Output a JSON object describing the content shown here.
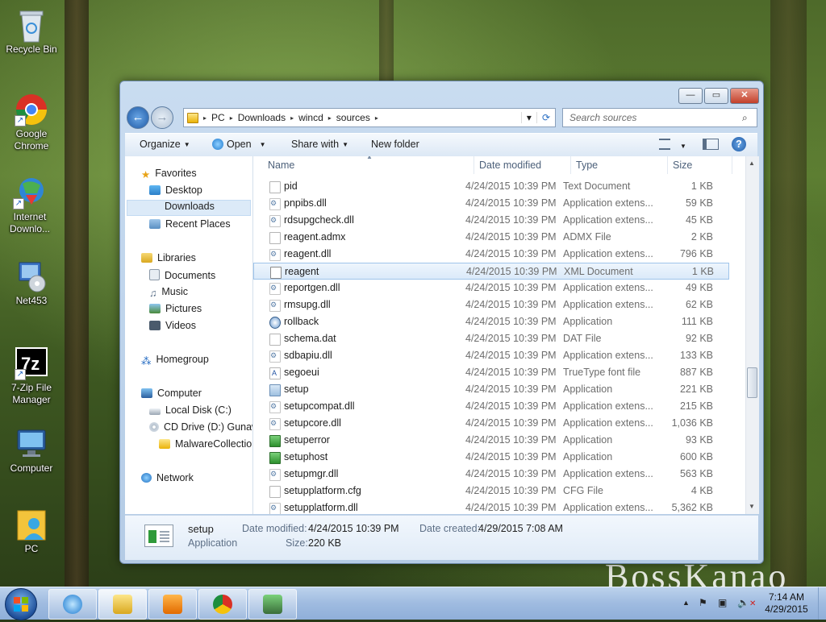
{
  "desktop": {
    "icons": [
      {
        "label": "Recycle Bin"
      },
      {
        "label": "Google Chrome"
      },
      {
        "label": "Internet Downlo..."
      },
      {
        "label": "Net453"
      },
      {
        "label": "7-Zip File Manager"
      },
      {
        "label": "Computer"
      },
      {
        "label": "PC"
      }
    ],
    "watermark": "BossKanao"
  },
  "window": {
    "controls": {
      "minimize": "—",
      "maximize": "▭",
      "close": "✕"
    },
    "nav": {
      "back": "←",
      "forward": "→"
    },
    "address": {
      "segments": [
        "PC",
        "Downloads",
        "wincd",
        "sources"
      ],
      "separator": "▸",
      "dropdown": "▾",
      "refresh": "⟳"
    },
    "search": {
      "placeholder": "Search sources",
      "icon": "⌕"
    },
    "toolbar": {
      "organize": "Organize",
      "open": "Open",
      "share_with": "Share with",
      "new_folder": "New folder",
      "help": "?"
    },
    "nav_pane": {
      "favorites": "Favorites",
      "desktop": "Desktop",
      "downloads": "Downloads",
      "recent_places": "Recent Places",
      "libraries": "Libraries",
      "documents": "Documents",
      "music": "Music",
      "pictures": "Pictures",
      "videos": "Videos",
      "homegroup": "Homegroup",
      "computer": "Computer",
      "local_disk": "Local Disk (C:)",
      "cd_drive": "CD Drive (D:) Gunaw",
      "malware": "MalwareCollection",
      "network": "Network"
    },
    "columns": {
      "name": "Name",
      "date": "Date modified",
      "type": "Type",
      "size": "Size"
    },
    "files": [
      {
        "name": "pid",
        "date": "4/24/2015 10:39 PM",
        "type": "Text Document",
        "size": "1 KB",
        "icon": "doc"
      },
      {
        "name": "pnpibs.dll",
        "date": "4/24/2015 10:39 PM",
        "type": "Application extens...",
        "size": "59 KB",
        "icon": "dll"
      },
      {
        "name": "rdsupgcheck.dll",
        "date": "4/24/2015 10:39 PM",
        "type": "Application extens...",
        "size": "45 KB",
        "icon": "dll"
      },
      {
        "name": "reagent.admx",
        "date": "4/24/2015 10:39 PM",
        "type": "ADMX File",
        "size": "2 KB",
        "icon": "doc"
      },
      {
        "name": "reagent.dll",
        "date": "4/24/2015 10:39 PM",
        "type": "Application extens...",
        "size": "796 KB",
        "icon": "dll"
      },
      {
        "name": "reagent",
        "date": "4/24/2015 10:39 PM",
        "type": "XML Document",
        "size": "1 KB",
        "icon": "xml"
      },
      {
        "name": "reportgen.dll",
        "date": "4/24/2015 10:39 PM",
        "type": "Application extens...",
        "size": "49 KB",
        "icon": "dll"
      },
      {
        "name": "rmsupg.dll",
        "date": "4/24/2015 10:39 PM",
        "type": "Application extens...",
        "size": "62 KB",
        "icon": "dll"
      },
      {
        "name": "rollback",
        "date": "4/24/2015 10:39 PM",
        "type": "Application",
        "size": "111 KB",
        "icon": "rb"
      },
      {
        "name": "schema.dat",
        "date": "4/24/2015 10:39 PM",
        "type": "DAT File",
        "size": "92 KB",
        "icon": "doc"
      },
      {
        "name": "sdbapiu.dll",
        "date": "4/24/2015 10:39 PM",
        "type": "Application extens...",
        "size": "133 KB",
        "icon": "dll"
      },
      {
        "name": "segoeui",
        "date": "4/24/2015 10:39 PM",
        "type": "TrueType font file",
        "size": "887 KB",
        "icon": "font"
      },
      {
        "name": "setup",
        "date": "4/24/2015 10:39 PM",
        "type": "Application",
        "size": "221 KB",
        "icon": "app"
      },
      {
        "name": "setupcompat.dll",
        "date": "4/24/2015 10:39 PM",
        "type": "Application extens...",
        "size": "215 KB",
        "icon": "dll"
      },
      {
        "name": "setupcore.dll",
        "date": "4/24/2015 10:39 PM",
        "type": "Application extens...",
        "size": "1,036 KB",
        "icon": "dll"
      },
      {
        "name": "setuperror",
        "date": "4/24/2015 10:39 PM",
        "type": "Application",
        "size": "93 KB",
        "icon": "grn"
      },
      {
        "name": "setuphost",
        "date": "4/24/2015 10:39 PM",
        "type": "Application",
        "size": "600 KB",
        "icon": "grn"
      },
      {
        "name": "setupmgr.dll",
        "date": "4/24/2015 10:39 PM",
        "type": "Application extens...",
        "size": "563 KB",
        "icon": "dll"
      },
      {
        "name": "setupplatform.cfg",
        "date": "4/24/2015 10:39 PM",
        "type": "CFG File",
        "size": "4 KB",
        "icon": "doc"
      },
      {
        "name": "setupplatform.dll",
        "date": "4/24/2015 10:39 PM",
        "type": "Application extens...",
        "size": "5,362 KB",
        "icon": "dll"
      }
    ],
    "selected_file": "reagent",
    "details": {
      "name": "setup",
      "kind": "Application",
      "date_modified_label": "Date modified:",
      "date_modified": "4/24/2015 10:39 PM",
      "size_label": "Size:",
      "size": "220 KB",
      "date_created_label": "Date created:",
      "date_created": "4/29/2015 7:08 AM"
    }
  },
  "taskbar": {
    "clock": {
      "time": "7:14 AM",
      "date": "4/29/2015"
    },
    "tray": {
      "up_arrow": "▲",
      "flag": "⚑",
      "network": "▣",
      "volume": "✕"
    }
  }
}
